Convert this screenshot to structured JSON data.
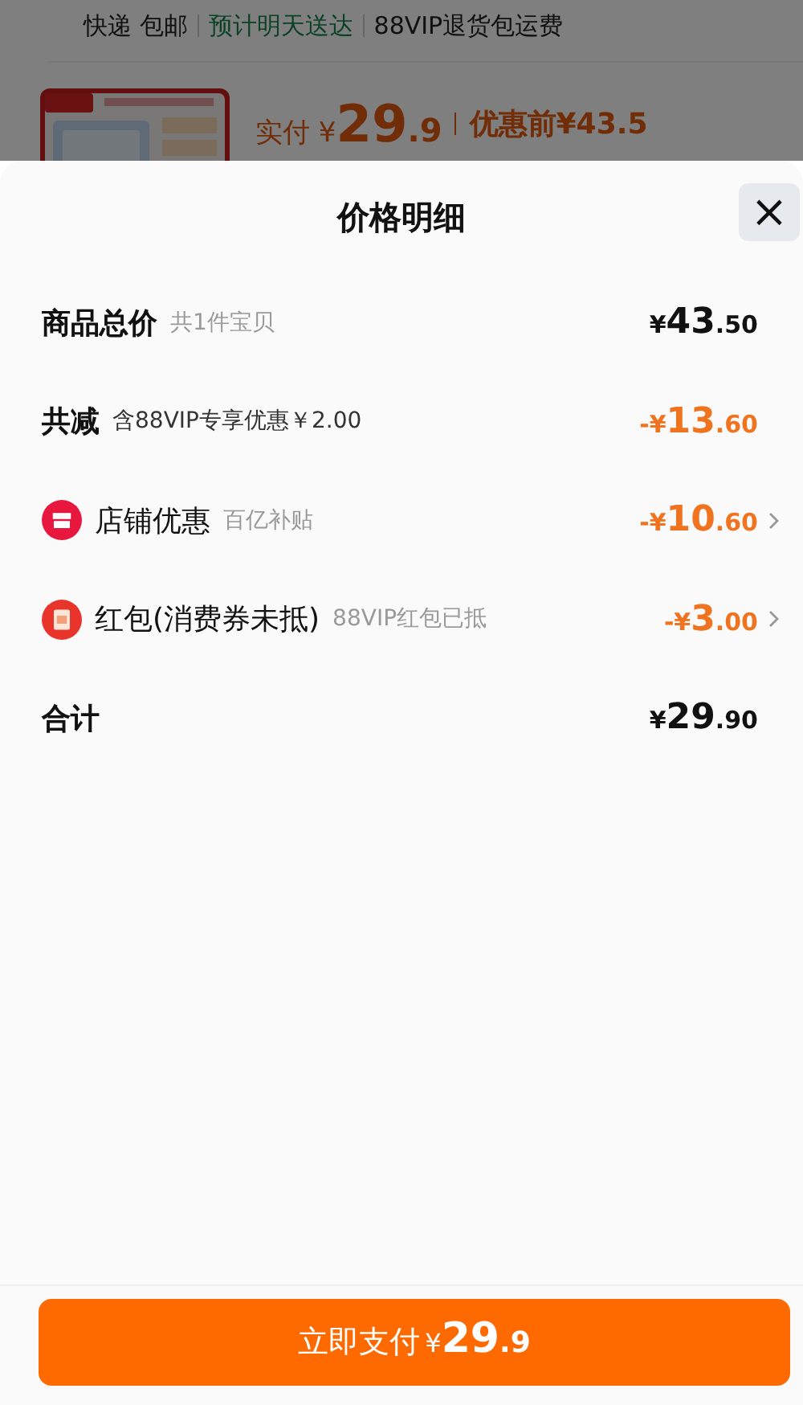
{
  "background": {
    "shipping": [
      {
        "text": "快递 包邮",
        "kind": "plain"
      },
      {
        "text": "预计明天送达",
        "kind": "highlight"
      },
      {
        "text": "88VIP退货包运费",
        "kind": "plain"
      }
    ],
    "product": {
      "kind": "picture",
      "paid_label": "实付",
      "currency": "¥",
      "integer": "29",
      "decimal": ".9",
      "original_price": "优惠前¥43.5"
    }
  },
  "sheet": {
    "title": "价格明细",
    "close": "×",
    "rows": [
      {
        "kind": "plain",
        "label": "商品总价",
        "note": "共1件宝贝",
        "prefix": "¥",
        "integer": "43",
        "decimal": ".50"
      },
      {
        "kind": "deduction",
        "label": "共减",
        "note": "含88VIP专享优惠￥2.00",
        "prefix": "-¥",
        "integer": "13",
        "decimal": ".60"
      },
      {
        "kind": "store",
        "label": "店铺优惠",
        "note": "百亿补贴",
        "prefix": "-¥",
        "integer": "10",
        "decimal": ".60"
      },
      {
        "kind": "red_packet",
        "label": "红包(消费券未抵)",
        "note": "88VIP红包已抵",
        "prefix": "-¥",
        "integer": "3",
        "decimal": ".00"
      },
      {
        "kind": "total",
        "label": "合计",
        "prefix": "¥",
        "integer": "29",
        "decimal": ".90"
      }
    ],
    "pay_button": {
      "label": "立即支付",
      "currency": "¥",
      "integer": "29",
      "decimal": ".9"
    }
  }
}
